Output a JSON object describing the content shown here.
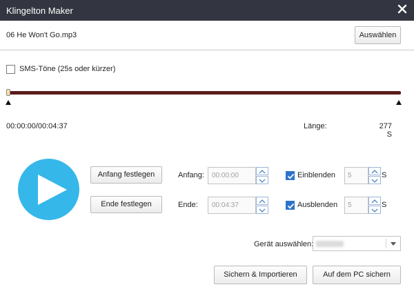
{
  "window": {
    "title": "Klingelton Maker"
  },
  "file": {
    "name": "06 He Won't Go.mp3",
    "choose_label": "Auswählen"
  },
  "sms": {
    "label": "SMS-Töne (25s oder kürzer)",
    "checked": false
  },
  "timeline": {
    "position_fraction": 0.0,
    "readout": "00:00:00/00:04:37",
    "length_label": "Länge:",
    "length_value": "277 S"
  },
  "controls": {
    "play_icon": "play-icon",
    "set_start_label": "Anfang festlegen",
    "set_end_label": "Ende festlegen",
    "start_label": "Anfang:",
    "start_value": "00:00:00",
    "end_label": "Ende:",
    "end_value": "00:04:37",
    "fade_in_label": "Einblenden",
    "fade_in_checked": true,
    "fade_in_value": "5",
    "fade_out_label": "Ausblenden",
    "fade_out_checked": true,
    "fade_out_value": "5",
    "unit": "S"
  },
  "device": {
    "label": "Gerät auswählen:",
    "selected": ""
  },
  "actions": {
    "save_import": "Sichern & Importieren",
    "save_pc": "Auf dem PC sichern"
  },
  "colors": {
    "titlebar": "#333640",
    "accent": "#35b7ea",
    "track": "#5b1b1b",
    "checkbox": "#2d74c9"
  }
}
